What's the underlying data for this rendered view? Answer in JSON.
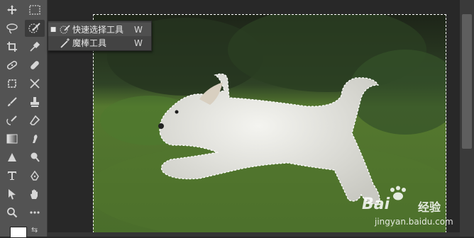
{
  "tools": [
    {
      "name": "move-tool",
      "icon": "move-icon",
      "glyph": "✥"
    },
    {
      "name": "marquee-tool",
      "icon": "marquee-icon",
      "glyph": "⬚"
    },
    {
      "name": "lasso-tool",
      "icon": "lasso-icon",
      "glyph": "ᘓ"
    },
    {
      "name": "quick-selection-tool",
      "icon": "quick-selection-icon",
      "glyph": "◌"
    },
    {
      "name": "crop-tool",
      "icon": "crop-icon",
      "glyph": "⌗"
    },
    {
      "name": "eyedropper-tool",
      "icon": "eyedropper-icon",
      "glyph": "✎"
    }
  ],
  "flyout": {
    "items": [
      {
        "label": "快速选择工具",
        "shortcut": "W",
        "selected": true
      },
      {
        "label": "魔棒工具",
        "shortcut": "W",
        "selected": false
      }
    ]
  },
  "watermark": {
    "brand": "Bai",
    "brand2": "经验",
    "url": "jingyan.baidu.com"
  }
}
